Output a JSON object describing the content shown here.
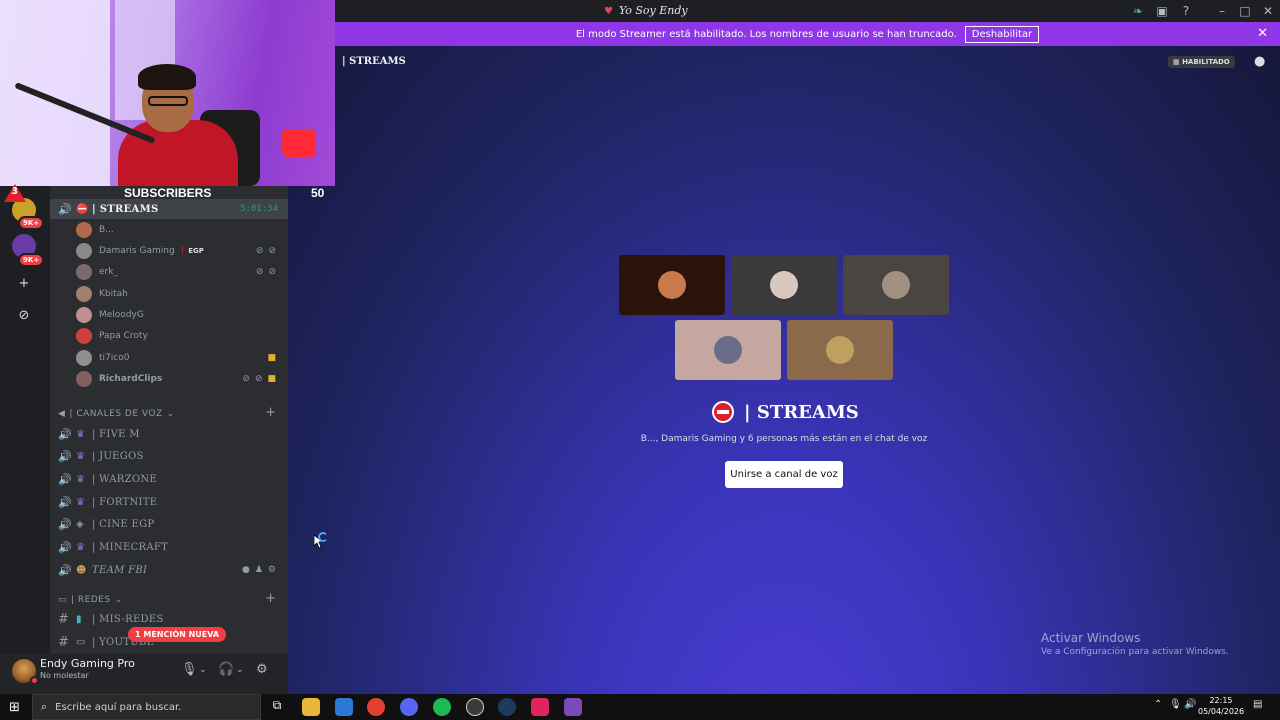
{
  "window": {
    "title": "Yo Soy Endy",
    "controls": [
      "leaf-icon",
      "screen-share-icon",
      "help-icon",
      "minimize-icon",
      "maximize-icon",
      "close-icon"
    ]
  },
  "banner": {
    "text": "El modo Streamer está habilitado. Los nombres de usuario se han truncado.",
    "button": "Deshabilitar"
  },
  "overlay": {
    "subscribers_label": "SUBSCRIBERS",
    "subscribers_count": "50",
    "alert_count": "3"
  },
  "rail": {
    "badges": [
      "9K+",
      "9K+"
    ],
    "add_server": "+",
    "discover": "⊘"
  },
  "channels": {
    "active_voice": {
      "label": "| STREAMS",
      "timer": "5:01:34"
    },
    "members": [
      {
        "name": "B...",
        "color": "#b06a4a"
      },
      {
        "name": "Damaris Gaming",
        "tag": "EGP",
        "color": "#8a8a8a"
      },
      {
        "name": "erk_",
        "color": "#7a6a6a"
      },
      {
        "name": "Kbitah",
        "color": "#a08070"
      },
      {
        "name": "MeloodyG",
        "color": "#c09090"
      },
      {
        "name": "Papa Croty",
        "color": "#d04040"
      },
      {
        "name": "ti7ico0",
        "color": "#909090"
      },
      {
        "name": "RichardClips",
        "color": "#806060"
      }
    ],
    "voice_category": "| CANALES DE VOZ",
    "voice_channels": [
      "| FIVE M",
      "| JUEGOS",
      "| WARZONE",
      "| FORTNITE",
      "| CINE EGP",
      "| MINECRAFT",
      "TEAM FBI"
    ],
    "redes_category": "| REDES",
    "text_channels": [
      "| MIS-REDES",
      "| YOUTUBE"
    ],
    "mention": "1 MENCIÓN NUEVA"
  },
  "user": {
    "name": "Endy Gaming Pro",
    "status": "No molestar"
  },
  "header": {
    "title": "| STREAMS",
    "badge": "HABILITADO"
  },
  "voice": {
    "tiles": [
      {
        "bg": "#2a130a",
        "av": "#c87a4a"
      },
      {
        "bg": "#3a3a3a",
        "av": "#d8c8c0"
      },
      {
        "bg": "#4a4540",
        "av": "#a09080"
      },
      {
        "bg": "#c4a8a0",
        "av": "#6a6a8a"
      },
      {
        "bg": "#8a6a4a",
        "av": "#c0a060"
      }
    ],
    "title": "| STREAMS",
    "subtitle": "B..., Damaris Gaming y 6 personas más están en el chat de voz",
    "join": "Unirse a canal de voz"
  },
  "activation": {
    "title": "Activar Windows",
    "subtitle": "Ve a Configuración para activar Windows."
  },
  "taskbar": {
    "search_placeholder": "Escribe aquí para buscar.",
    "time": "22:15",
    "date": "05/04/2026",
    "apps": [
      {
        "name": "file-explorer-icon",
        "color": "#e8b83a"
      },
      {
        "name": "store-icon",
        "color": "#2b7bd6"
      },
      {
        "name": "chrome-icon",
        "color": "#e34133"
      },
      {
        "name": "discord-icon",
        "color": "#5865f2"
      },
      {
        "name": "spotify-icon",
        "color": "#1db954"
      },
      {
        "name": "obs-icon",
        "color": "#3a3a3a"
      },
      {
        "name": "steam-icon",
        "color": "#1b3a5c"
      },
      {
        "name": "tiktok-icon",
        "color": "#e0245e"
      },
      {
        "name": "app-icon",
        "color": "#7a4ab8"
      }
    ]
  }
}
